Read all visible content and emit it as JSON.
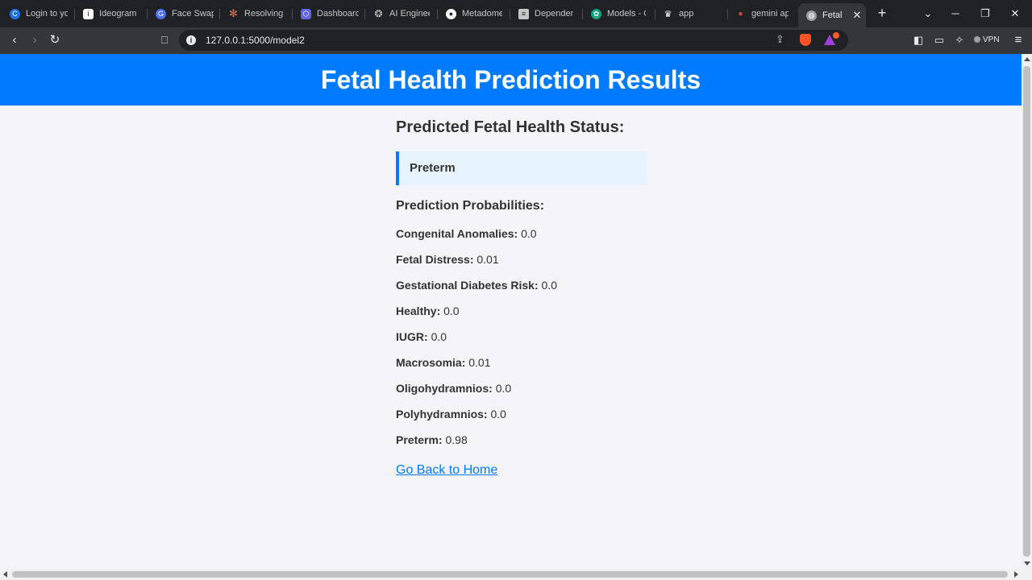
{
  "browser": {
    "tabs": [
      {
        "title": "Login to yo",
        "icon": "c-logo-icon",
        "color": "#1a73e8"
      },
      {
        "title": "Ideogram",
        "icon": "ideogram-icon",
        "color": "#ffffff"
      },
      {
        "title": "Face Swap",
        "icon": "faceswap-icon",
        "color": "#4c6ef5"
      },
      {
        "title": "Resolving C",
        "icon": "claude-icon",
        "color": "#d97757"
      },
      {
        "title": "Dashboard",
        "icon": "hexagon-icon",
        "color": "#6366f1"
      },
      {
        "title": "AI Enginee",
        "icon": "openai-icon",
        "color": "#c4c7c5"
      },
      {
        "title": "Metadome",
        "icon": "github-icon",
        "color": "#ffffff"
      },
      {
        "title": "Dependen",
        "icon": "document-icon",
        "color": "#c4c7c5"
      },
      {
        "title": "Models - C",
        "icon": "chatgpt-icon",
        "color": "#10a37f"
      },
      {
        "title": "app",
        "icon": "crown-icon",
        "color": "#ffffff"
      },
      {
        "title": "gemini ap",
        "icon": "gemini-icon",
        "color": "#ea4335"
      },
      {
        "title": "Fetal H",
        "icon": "globe-icon",
        "color": "#9aa0a6",
        "active": true
      }
    ],
    "new_tab": "+",
    "url": "127.0.0.1:5000/model2",
    "vpn_label": "VPN"
  },
  "page": {
    "title": "Fetal Health Prediction Results",
    "status_heading": "Predicted Fetal Health Status:",
    "status_value": "Preterm",
    "probabilities_heading": "Prediction Probabilities:",
    "probabilities": [
      {
        "label": "Congenital Anomalies:",
        "value": "0.0"
      },
      {
        "label": "Fetal Distress:",
        "value": "0.01"
      },
      {
        "label": "Gestational Diabetes Risk:",
        "value": "0.0"
      },
      {
        "label": "Healthy:",
        "value": "0.0"
      },
      {
        "label": "IUGR:",
        "value": "0.0"
      },
      {
        "label": "Macrosomia:",
        "value": "0.01"
      },
      {
        "label": "Oligohydramnios:",
        "value": "0.0"
      },
      {
        "label": "Polyhydramnios:",
        "value": "0.0"
      },
      {
        "label": "Preterm:",
        "value": "0.98"
      }
    ],
    "home_link": "Go Back to Home"
  },
  "colors": {
    "header_bg": "#007bff",
    "page_bg": "#f4f4f9",
    "status_bg": "#e8f4fd",
    "accent": "#007bff"
  }
}
